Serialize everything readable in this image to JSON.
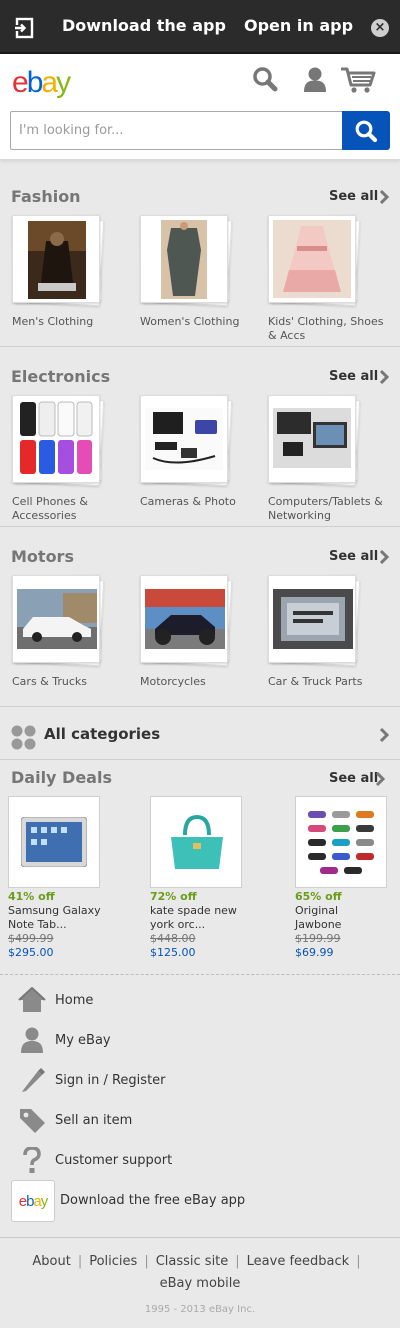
{
  "banner": {
    "download_label": "Download the app",
    "open_label": "Open in app",
    "close_glyph": "×",
    "icons": [
      "open-in-app-icon",
      "close-icon"
    ]
  },
  "header": {
    "logo": {
      "e": "e",
      "b": "b",
      "a": "a",
      "y": "y"
    },
    "icons": [
      "search-icon",
      "user-icon",
      "cart-icon"
    ],
    "search": {
      "placeholder": "I'm looking for..."
    },
    "colors": {
      "search_button": "#0654ba",
      "logo_e": "#e53238",
      "logo_b": "#0064d2",
      "logo_a": "#f5af02",
      "logo_y": "#86b817"
    }
  },
  "categories": [
    {
      "title": "Fashion",
      "see_all": "See all",
      "tiles": [
        {
          "label": "Men's Clothing"
        },
        {
          "label": "Women's Clothing"
        },
        {
          "label": "Kids' Clothing, Shoes & Accs"
        }
      ]
    },
    {
      "title": "Electronics",
      "see_all": "See all",
      "tiles": [
        {
          "label": "Cell Phones & Accessories"
        },
        {
          "label": "Cameras & Photo"
        },
        {
          "label": "Computers/Tablets & Networking"
        }
      ]
    },
    {
      "title": "Motors",
      "see_all": "See all",
      "tiles": [
        {
          "label": "Cars & Trucks"
        },
        {
          "label": "Motorcycles"
        },
        {
          "label": "Car & Truck Parts"
        }
      ]
    }
  ],
  "all_categories": {
    "label": "All categories",
    "icon": "categories-grid-icon"
  },
  "daily_deals": {
    "title": "Daily Deals",
    "see_all": "See all",
    "items": [
      {
        "discount": "41% off",
        "name_line1": "Samsung Galaxy",
        "name_line2": "Note Tab...",
        "old_price": "$499.99",
        "new_price": "$295.00"
      },
      {
        "discount": "72% off",
        "name_line1": "kate spade new",
        "name_line2": "york orc...",
        "old_price": "$448.00",
        "new_price": "$125.00"
      },
      {
        "discount": "65% off",
        "name_line1": "Original",
        "name_line2": "Jawbone",
        "old_price": "$199.99",
        "new_price": "$69.99"
      }
    ]
  },
  "menu": {
    "items": [
      {
        "label": "Home",
        "icon": "home-icon"
      },
      {
        "label": "My eBay",
        "icon": "user-icon"
      },
      {
        "label": "Sign in / Register",
        "icon": "pencil-icon"
      },
      {
        "label": "Sell an item",
        "icon": "tag-icon"
      },
      {
        "label": "Customer support",
        "icon": "question-icon"
      }
    ],
    "app_item": {
      "label": "Download the free eBay app",
      "icon": "ebay-app-icon"
    }
  },
  "footer": {
    "links": [
      "About",
      "Policies",
      "Classic site",
      "Leave feedback",
      "eBay mobile"
    ],
    "separator": "|",
    "copyright": "1995 - 2013 eBay Inc."
  }
}
